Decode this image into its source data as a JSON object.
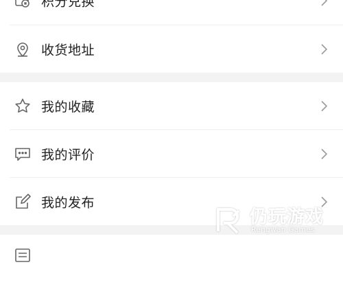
{
  "menu_group_1": [
    {
      "label": "积分兑换",
      "icon": "points-exchange-icon"
    },
    {
      "label": "收货地址",
      "icon": "location-pin-icon"
    }
  ],
  "menu_group_2": [
    {
      "label": "我的收藏",
      "icon": "star-icon"
    },
    {
      "label": "我的评价",
      "icon": "comment-icon"
    },
    {
      "label": "我的发布",
      "icon": "edit-icon"
    }
  ],
  "menu_group_3": [
    {
      "label": "",
      "icon": "list-icon"
    }
  ],
  "watermark": {
    "title": "仍玩游戏",
    "subtitle": "Rengwan Games"
  },
  "colors": {
    "text": "#222222",
    "icon": "#666666",
    "chevron": "#9a9a9a",
    "separator_band": "#f3f3f3",
    "divider": "#eeeeee"
  }
}
